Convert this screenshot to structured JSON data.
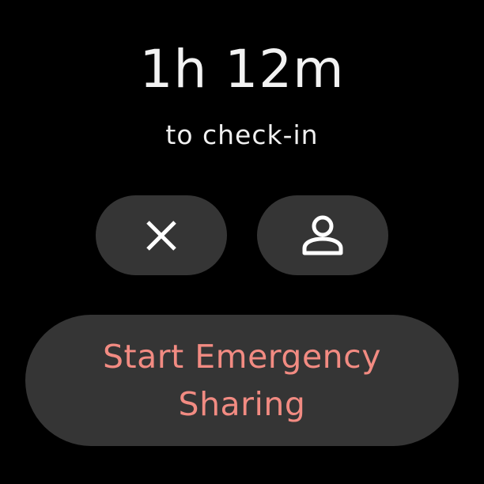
{
  "timer": {
    "remaining": "1h 12m",
    "caption": "to check-in"
  },
  "actions": {
    "cancel_icon": "close-icon",
    "contacts_icon": "person-icon",
    "emergency_label": "Start Emergency Sharing"
  },
  "colors": {
    "background": "#000000",
    "button_surface": "#353535",
    "icon": "#ffffff",
    "emergency_text": "#f28b82"
  }
}
